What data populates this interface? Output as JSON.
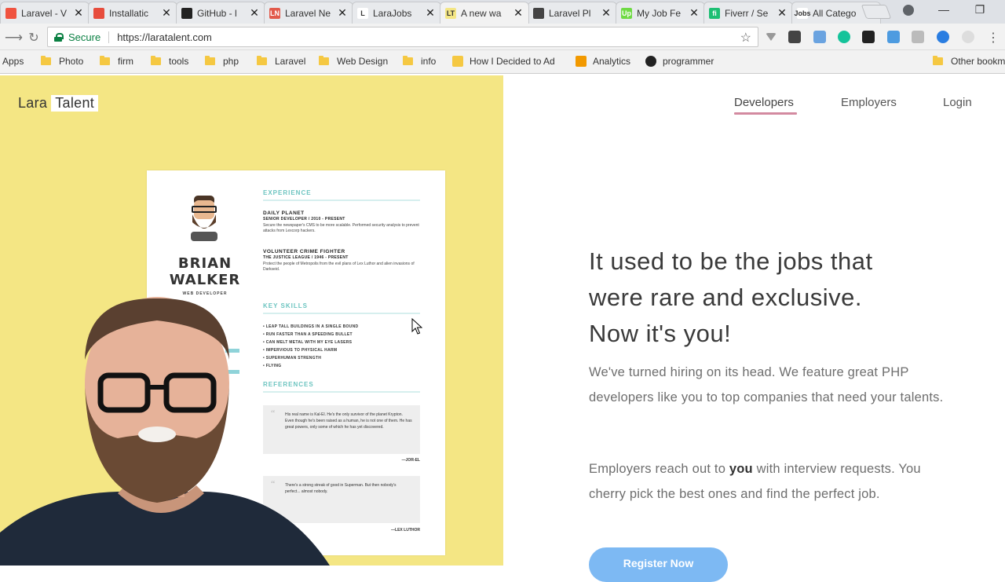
{
  "tabs": [
    {
      "label": "Laravel - V",
      "fav_color": "#f05340",
      "fav_text": ""
    },
    {
      "label": "Installatic",
      "fav_color": "#e74c3c",
      "fav_text": ""
    },
    {
      "label": "GitHub - l",
      "fav_color": "#222222",
      "fav_text": ""
    },
    {
      "label": "Laravel Ne",
      "fav_color": "#e25a4b",
      "fav_text": "LN"
    },
    {
      "label": "LaraJobs",
      "fav_color": "#ffffff",
      "fav_text": "L"
    },
    {
      "label": "A new wa",
      "fav_color": "#f4e684",
      "fav_text": "LT"
    },
    {
      "label": "Laravel Pl",
      "fav_color": "#444444",
      "fav_text": ""
    },
    {
      "label": "My Job Fe",
      "fav_color": "#6fda44",
      "fav_text": "Up"
    },
    {
      "label": "Fiverr / Se",
      "fav_color": "#1dbf73",
      "fav_text": "fi"
    },
    {
      "label": "All Catego",
      "fav_color": "#ffffff",
      "fav_text": "Jobs"
    }
  ],
  "tab_close_glyph": "✕",
  "window_controls": {
    "minimize": "—",
    "restore": "❐",
    "close": "✕"
  },
  "address_bar": {
    "secure_label": "Secure",
    "url": "https://laratalent.com"
  },
  "bookmarks": [
    {
      "label": "Apps",
      "type": "apps"
    },
    {
      "label": "Photo",
      "type": "folder"
    },
    {
      "label": "firm",
      "type": "folder"
    },
    {
      "label": "tools",
      "type": "folder"
    },
    {
      "label": "php",
      "type": "folder"
    },
    {
      "label": "Laravel",
      "type": "folder"
    },
    {
      "label": "Web Design",
      "type": "folder"
    },
    {
      "label": "info",
      "type": "folder"
    },
    {
      "label": "How I Decided to Ad",
      "type": "bulb"
    },
    {
      "label": "Analytics",
      "type": "analytics"
    },
    {
      "label": "programmer",
      "type": "github"
    },
    {
      "label": "Other bookm",
      "type": "folder"
    }
  ],
  "site": {
    "logo_part1": "Lara",
    "logo_part2": "Talent",
    "nav": {
      "developers": "Developers",
      "employers": "Employers",
      "login": "Login"
    },
    "headline_line1": "It used to be the jobs that",
    "headline_line2": "were rare and exclusive.",
    "headline_line3": "Now it's you!",
    "para1": "We've turned hiring on its head. We feature great PHP developers like you to top companies that need your talents.",
    "para2_pre": "Employers reach out to ",
    "para2_bold": "you",
    "para2_post": " with interview requests. You cherry pick the best ones and find the perfect job.",
    "cta_label": "Register Now"
  },
  "resume": {
    "name_line1": "BRIAN",
    "name_line2": "WALKER",
    "title": "WEB DEVELOPER",
    "experience_heading": "EXPERIENCE",
    "job1_company": "DAILY PLANET",
    "job1_role": "SENIOR DEVELOPER / 2010 - PRESENT",
    "job1_desc": "Secure the newspaper's CMS to be more scalable. Performed security analysis to prevent attacks from Lexcorp hackers.",
    "job2_company": "VOLUNTEER CRIME FIGHTER",
    "job2_role": "THE JUSTICE LEAGUE / 1946 - PRESENT",
    "job2_desc": "Protect the people of Metropolis from the evil plans of Lex Luthor and alien invasions of Darkseid.",
    "skills_heading": "KEY SKILLS",
    "skills": [
      "• LEAP TALL BUILDINGS IN A SINGLE BOUND",
      "• RUN FASTER THAN A SPEEDING BULLET",
      "• CAN MELT METAL WITH MY EYE LASERS",
      "• IMPERVIOUS TO PHYSICAL HARM",
      "• SUPERHUMAN STRENGTH",
      "• FLYING"
    ],
    "references_heading": "REFERENCES",
    "quote1": "His real name is Kal-El. He's the only survivor of the planet Krypton. Even though he's been raised as a human, he is not one of them. He has great powers, only some of which he has yet discovered.",
    "quote1_author": "—JOR-EL",
    "quote2": "There's a strong streak of good in Superman. But then nobody's perfect... almost nobody.",
    "quote2_author": "—LEX LUTHOR"
  }
}
